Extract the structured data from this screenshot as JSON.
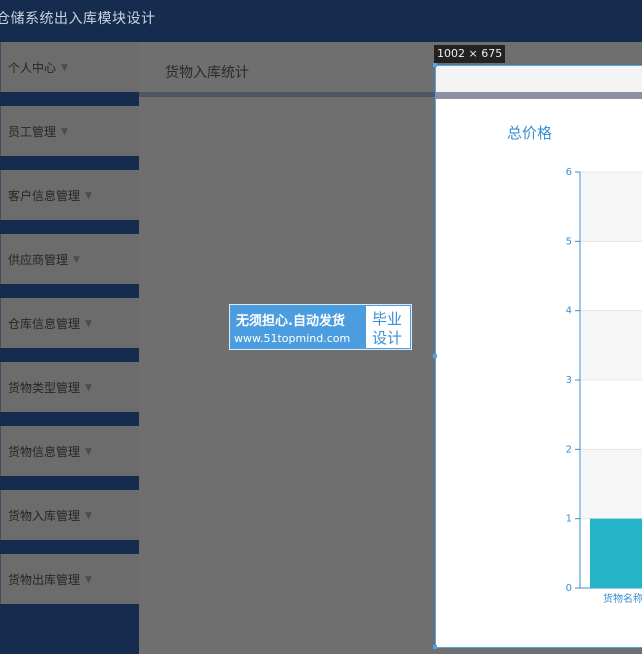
{
  "app": {
    "title": "仓储系统出入库模块设计"
  },
  "sidebar": {
    "items": [
      {
        "label": "个人中心"
      },
      {
        "label": "员工管理"
      },
      {
        "label": "客户信息管理"
      },
      {
        "label": "供应商管理"
      },
      {
        "label": "仓库信息管理"
      },
      {
        "label": "货物类型管理"
      },
      {
        "label": "货物信息管理"
      },
      {
        "label": "货物入库管理"
      },
      {
        "label": "货物出库管理"
      }
    ]
  },
  "content": {
    "title": "货物入库统计"
  },
  "devtools": {
    "dimensions": "1002 × 675"
  },
  "watermark": {
    "line1": "无须担心.自动发货",
    "line2": "www.51topmind.com",
    "badge_line1": "毕业",
    "badge_line2": "设计"
  },
  "chart_data": {
    "type": "bar",
    "title": "总价格",
    "categories": [
      "货物名称"
    ],
    "values": [
      1
    ],
    "ylim": [
      0,
      6
    ],
    "yticks": [
      "0",
      "1",
      "2",
      "3",
      "4",
      "5",
      "6"
    ],
    "bar_color": "#26b4c9",
    "title_color": "#3c8fd0"
  }
}
